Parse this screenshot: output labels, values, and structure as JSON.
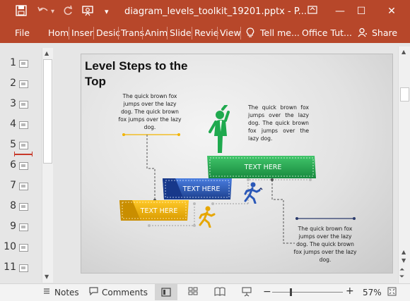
{
  "window": {
    "title": "diagram_levels_toolkit_19201.pptx - P...",
    "controls": {
      "restore": "❐",
      "minimize": "—",
      "maximize": "☐",
      "close": "✕"
    }
  },
  "quick_access": {
    "save": "💾",
    "undo": "↶",
    "redo": "↻",
    "present": "⊡",
    "more": "▾"
  },
  "ribbon": {
    "file": "File",
    "tabs": [
      "Hom",
      "Inser",
      "Desic",
      "Trans",
      "Anim",
      "Slide",
      "Revie",
      "View"
    ],
    "tell_me": "Tell me...",
    "office_tut": "Office Tut...",
    "share": "Share"
  },
  "thumbnails": [
    "1",
    "2",
    "3",
    "4",
    "5",
    "6",
    "7",
    "8",
    "9",
    "10",
    "11"
  ],
  "slide": {
    "title": "Level Steps to the Top",
    "text_top_left": "The quick brown fox jumps over the lazy dog. The quick brown fox jumps over the lazy dog.",
    "text_top_right": "The quick brown fox jumps over the lazy dog. The quick brown fox jumps over the lazy dog.",
    "text_bottom_right": "The quick brown fox jumps over the lazy dog. The quick brown fox jumps over the lazy dog.",
    "step_green": "TEXT HERE",
    "step_blue": "TEXT HERE",
    "step_yellow": "TEXT HERE",
    "colors": {
      "green": "#1fa94e",
      "blue": "#2b58b8",
      "yellow": "#f2b400",
      "accent": "#b7472a"
    }
  },
  "status": {
    "notes": "Notes",
    "comments": "Comments",
    "zoom_percent": "57%",
    "zoom_level": 0.57
  }
}
